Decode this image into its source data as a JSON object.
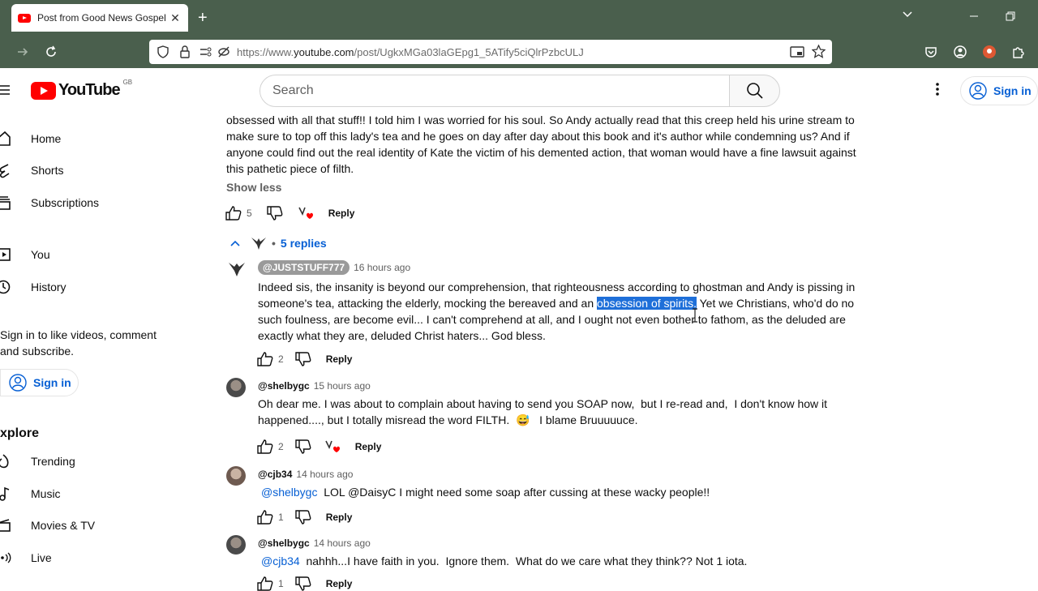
{
  "browser": {
    "tab_title": "Post from Good News Gospel II",
    "tab_close": "✕",
    "new_tab": "+",
    "url_prefix": "https://www.",
    "url_domain": "youtube.com",
    "url_path": "/post/UgkxMGa03laGEpg1_5ATify5ciQlrPzbcULJ"
  },
  "header": {
    "logo_text": "YouTube",
    "region": "GB",
    "search_placeholder": "Search",
    "sign_in": "Sign in"
  },
  "sidebar": {
    "items": [
      {
        "label": "Home",
        "icon": "home-icon"
      },
      {
        "label": "Shorts",
        "icon": "shorts-icon"
      },
      {
        "label": "Subscriptions",
        "icon": "subscriptions-icon"
      },
      {
        "label": "You",
        "icon": "you-icon"
      },
      {
        "label": "History",
        "icon": "history-icon"
      }
    ],
    "signin_prompt": "Sign in to like videos, comment and subscribe.",
    "signin_button": "Sign in",
    "explore_heading": "xplore",
    "explore_items": [
      {
        "label": "Trending",
        "icon": "trending-icon"
      },
      {
        "label": "Music",
        "icon": "music-icon"
      },
      {
        "label": "Movies & TV",
        "icon": "movies-icon"
      },
      {
        "label": "Live",
        "icon": "live-icon"
      }
    ]
  },
  "main_comment": {
    "lines": [
      "obsessed with all that stuff!! I told him I was worried for his soul. So Andy actually read that this creep held his urine stream to",
      "make sure to top off this lady's tea and he goes on day after day about this book and it's author while condemning us? And if",
      "anyone could find out the real identity of Kate the victim of his demented action, that woman would have a fine lawsuit against",
      "this pathetic piece of filth."
    ],
    "show_less": "Show less",
    "likes": "5",
    "reply": "Reply",
    "replies_label": "5 replies",
    "bullet": "•"
  },
  "replies": [
    {
      "author": "@JUSTSTUFF777",
      "time": "16 hours ago",
      "line1": "Indeed sis, the insanity is beyond our comprehension, that righteousness according to ghostman and Andy is pissing in",
      "line2_pre": "someone's tea, attacking the elderly, mocking the bereaved and an ",
      "line2_hl": "obsession of spirits.",
      "line2_post": " Yet we Christians, who'd do no",
      "line3": "such foulness, are become evil... I can't comprehend at all, and I ought not even bother to fathom, as the deluded are",
      "line4": "exactly what they are, deluded Christ haters... God bless.",
      "likes": "2",
      "reply": "Reply"
    },
    {
      "author": "@shelbygc",
      "time": "15 hours ago",
      "line1": "Oh dear me. I was about to complain about having to send you SOAP now,  but I re-read and,  I don't know how it",
      "line2": "happened...., but I totally misread the word FILTH.  😅   I blame Bruuuuuce.",
      "likes": "2",
      "reply": "Reply"
    },
    {
      "author": "@cjb34",
      "time": "14 hours ago",
      "mention": "@shelbygc",
      "text": "  LOL @DaisyC I might need some soap after cussing at these wacky people!!",
      "likes": "1",
      "reply": "Reply"
    },
    {
      "author": "@shelbygc",
      "time": "14 hours ago",
      "mention": "@cjb34",
      "text": "  nahhh...I have faith in you.  Ignore them.  What do we care what they think?? Not 1 iota.",
      "likes": "1",
      "reply": "Reply"
    }
  ],
  "colors": {
    "chrome": "#4a5f4d",
    "brand_red": "#ff0000",
    "link_blue": "#065fd4",
    "highlight": "#1e6fd9"
  }
}
